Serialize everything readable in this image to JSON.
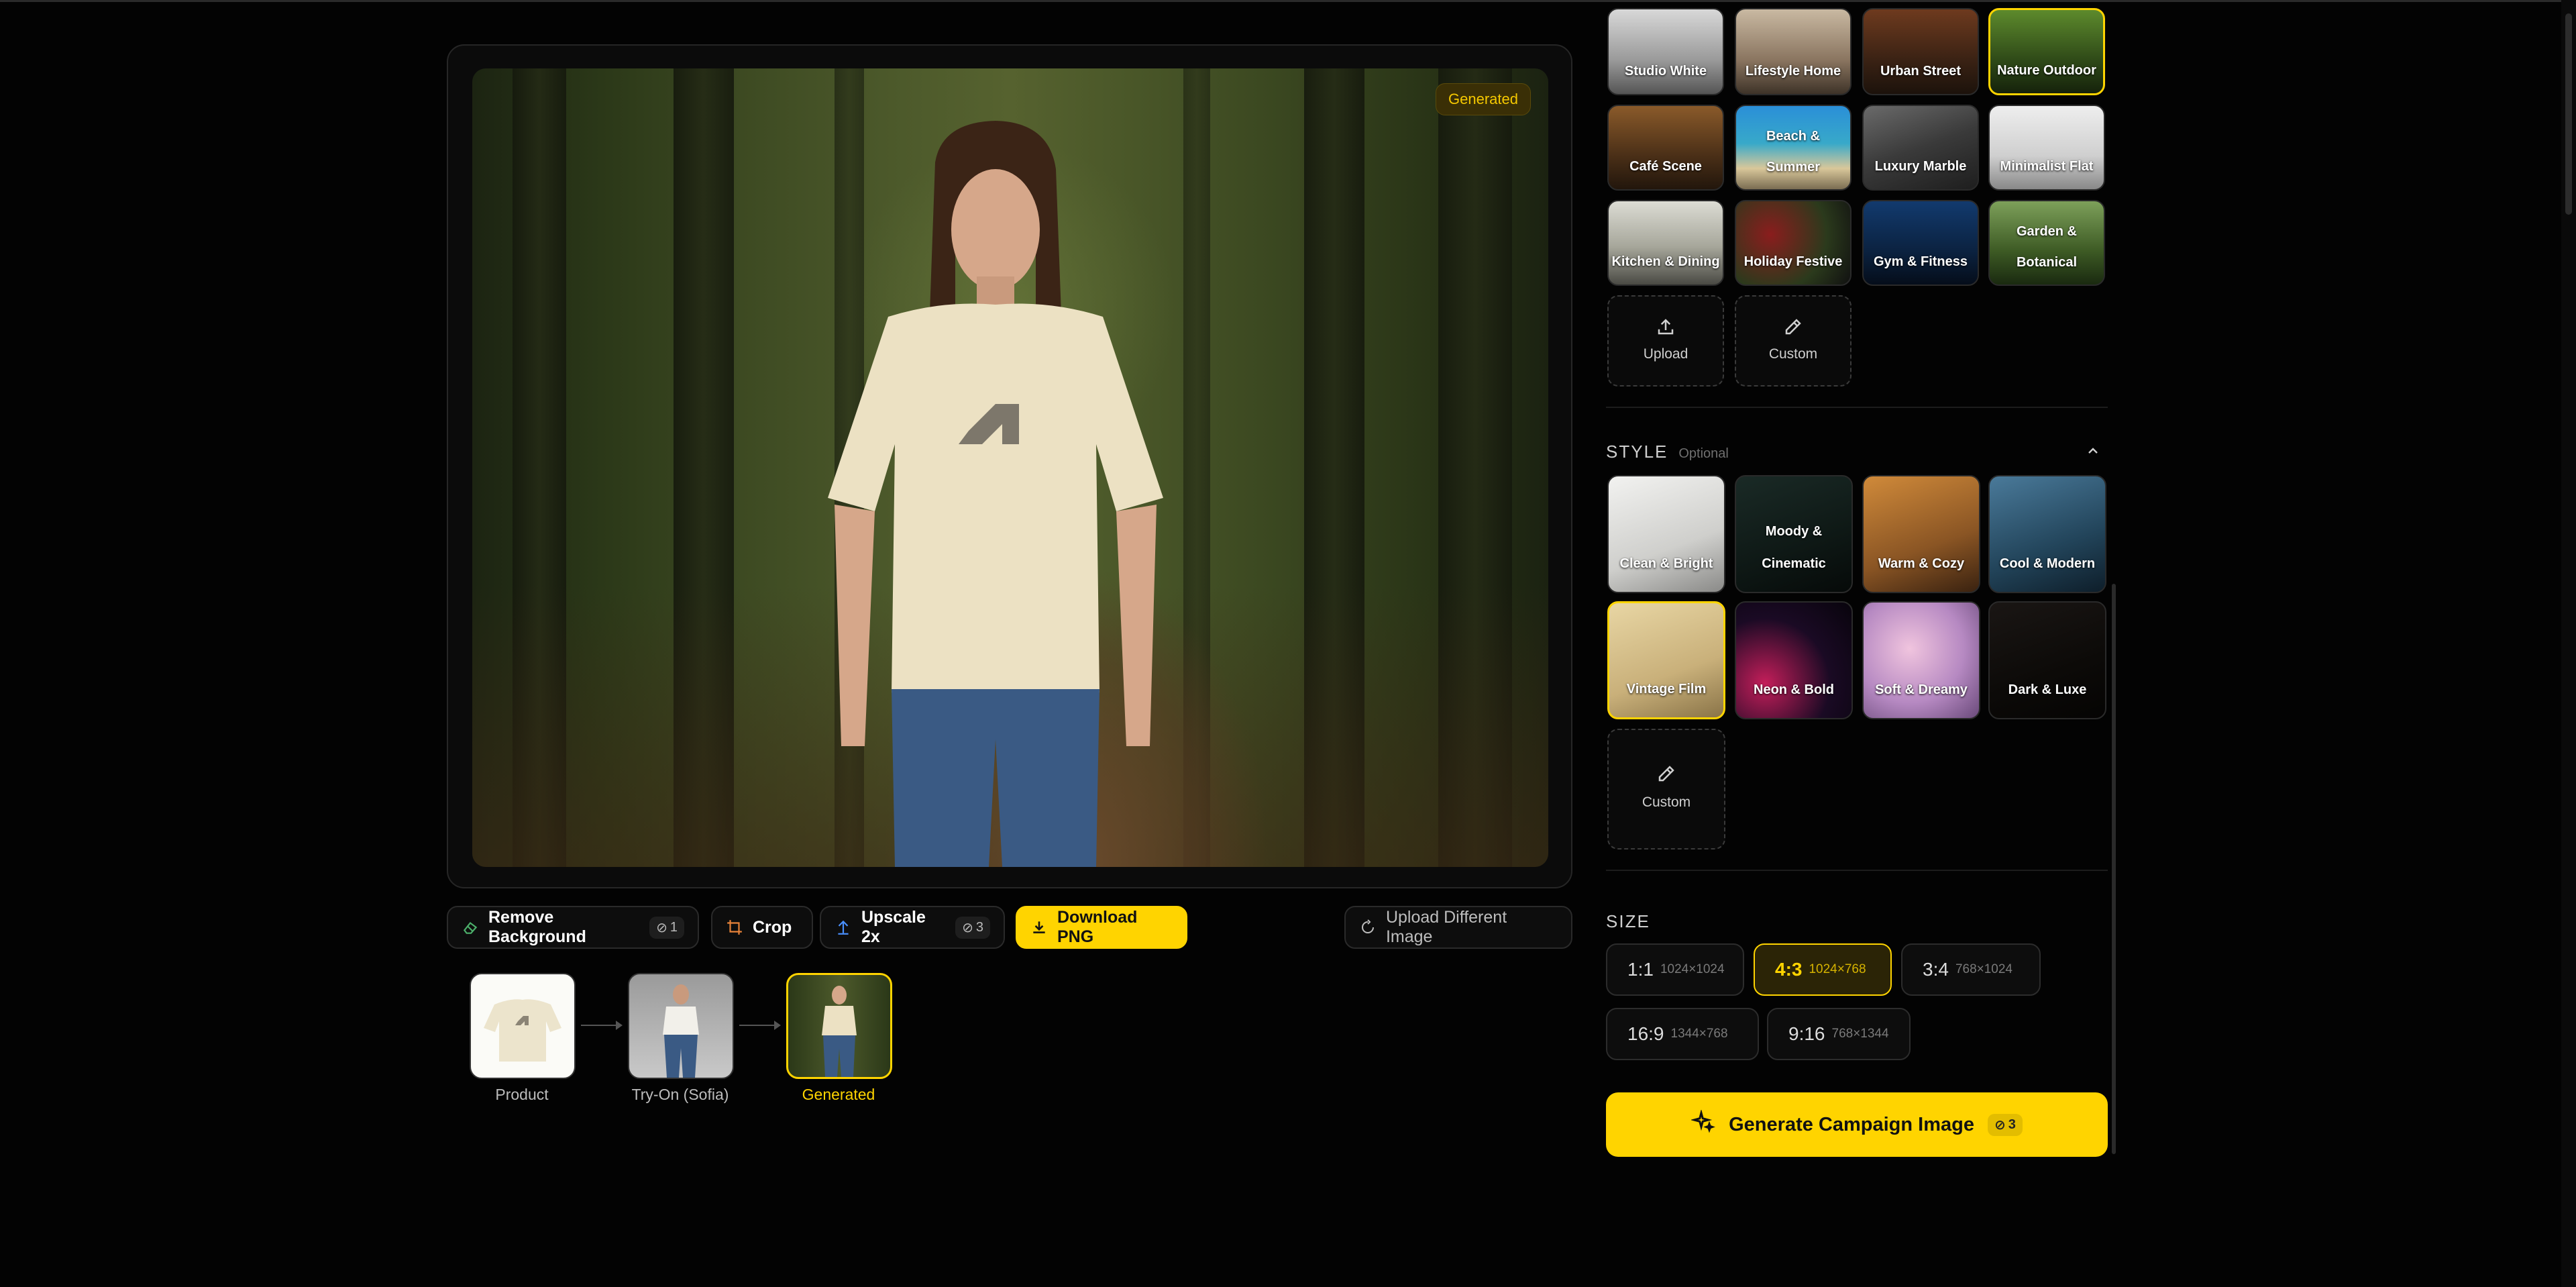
{
  "preview": {
    "badge": "Generated"
  },
  "toolbar": {
    "remove_bg": {
      "label": "Remove Background",
      "cost": "1"
    },
    "crop": {
      "label": "Crop"
    },
    "upscale": {
      "label": "Upscale 2x",
      "cost": "3"
    },
    "download": {
      "label": "Download PNG"
    },
    "upload_different": {
      "label": "Upload Different Image"
    }
  },
  "pipeline": [
    {
      "label": "Product"
    },
    {
      "label": "Try-On (Sofia)"
    },
    {
      "label": "Generated"
    }
  ],
  "scenes": [
    {
      "label": "Studio White"
    },
    {
      "label": "Lifestyle Home"
    },
    {
      "label": "Urban Street"
    },
    {
      "label": "Nature Outdoor",
      "selected": true
    },
    {
      "label": "Café Scene"
    },
    {
      "label": "Beach & Summer"
    },
    {
      "label": "Luxury Marble"
    },
    {
      "label": "Minimalist Flat"
    },
    {
      "label": "Kitchen & Dining"
    },
    {
      "label": "Holiday Festive"
    },
    {
      "label": "Gym & Fitness"
    },
    {
      "label": "Garden & Botanical"
    }
  ],
  "scene_actions": {
    "upload": "Upload",
    "custom": "Custom"
  },
  "style": {
    "title": "STYLE",
    "optional": "Optional",
    "items": [
      {
        "label": "Clean & Bright"
      },
      {
        "label": "Moody & Cinematic"
      },
      {
        "label": "Warm & Cozy"
      },
      {
        "label": "Cool & Modern"
      },
      {
        "label": "Vintage Film",
        "selected": true
      },
      {
        "label": "Neon & Bold"
      },
      {
        "label": "Soft & Dreamy"
      },
      {
        "label": "Dark & Luxe"
      }
    ],
    "custom": "Custom"
  },
  "size": {
    "title": "SIZE",
    "options": [
      {
        "ratio": "1:1",
        "dims": "1024×1024"
      },
      {
        "ratio": "4:3",
        "dims": "1024×768",
        "selected": true
      },
      {
        "ratio": "3:4",
        "dims": "768×1024"
      },
      {
        "ratio": "16:9",
        "dims": "1344×768"
      },
      {
        "ratio": "9:16",
        "dims": "768×1344"
      }
    ]
  },
  "generate": {
    "label": "Generate Campaign Image",
    "cost": "3"
  },
  "colors": {
    "accent": "#ffd400",
    "background": "#030303"
  }
}
